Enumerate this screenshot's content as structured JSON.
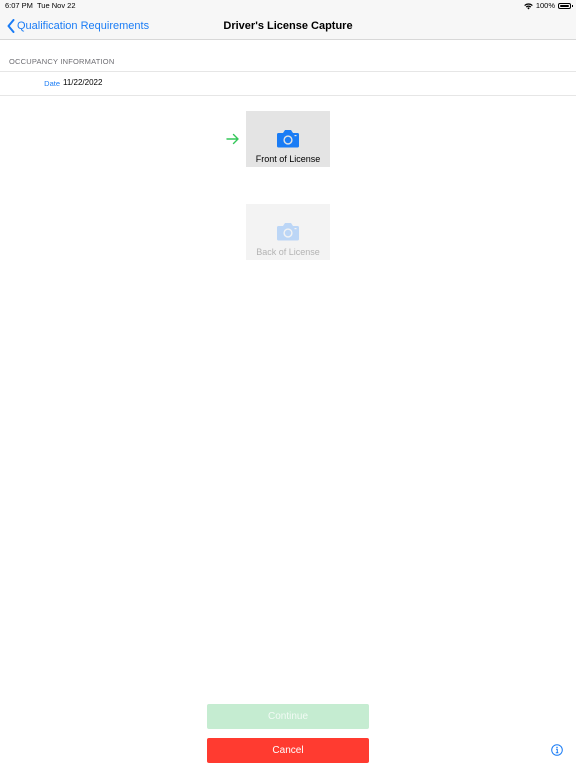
{
  "status_bar": {
    "time": "6:07 PM",
    "date": "Tue Nov 22",
    "battery": "100%",
    "icons": [
      "wifi-icon",
      "battery-icon"
    ]
  },
  "nav": {
    "back_label": "Qualification Requirements",
    "back_icon": "chevron-left-icon",
    "title": "Driver's License Capture"
  },
  "section": {
    "header": "OCCUPANCY INFORMATION"
  },
  "date_row": {
    "label": "Date",
    "value": "11/22/2022"
  },
  "capture": {
    "indicator_icon": "arrow-right-icon",
    "front": {
      "label": "Front of License",
      "icon": "camera-icon"
    },
    "back": {
      "label": "Back of License",
      "icon": "camera-icon"
    }
  },
  "buttons": {
    "continue_label": "Continue",
    "cancel_label": "Cancel"
  },
  "footer": {
    "info_icon": "info-icon"
  },
  "colors": {
    "accent": "#1a7cf5",
    "arrow": "#34c759",
    "continue_disabled": "#c5ecd1",
    "cancel": "#ff3b30"
  }
}
